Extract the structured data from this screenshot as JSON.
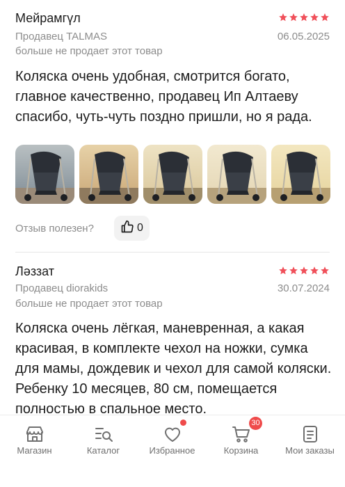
{
  "colors": {
    "star": "#f0505a",
    "accent": "#ef4b4b",
    "muted": "#8c8c8c",
    "icon": "#6f6f6f"
  },
  "reviews": [
    {
      "author": "Мейрамгүл",
      "rating": 5,
      "seller": "Продавец TALMAS",
      "date": "06.05.2025",
      "status": "больше не продает этот товар",
      "text": "Коляска очень удобная, смотрится богато, главное качественно, продавец Ип Алтаеву спасибо, чуть-чуть поздно пришли, но я рада.",
      "photos": [
        "stroller-photo",
        "stroller-photo",
        "stroller-photo",
        "stroller-photo",
        "stroller-photo"
      ],
      "helpful_label": "Отзыв полезен?",
      "likes": "0"
    },
    {
      "author": "Ләззат",
      "rating": 5,
      "seller": "Продавец diorakids",
      "date": "30.07.2024",
      "status": "больше не продает этот товар",
      "text": "Коляска очень лёгкая, маневренная, а какая красивая, в комплекте чехол на ножки, сумка для мамы, дождевик и чехол для самой коляски. Ребенку 10 месяцев, 80 см, помещается полностью в спальное место."
    }
  ],
  "tabbar": [
    {
      "label": "Магазин",
      "icon": "shop-icon"
    },
    {
      "label": "Каталог",
      "icon": "catalog-icon"
    },
    {
      "label": "Избранное",
      "icon": "heart-icon",
      "has_dot": true
    },
    {
      "label": "Корзина",
      "icon": "cart-icon",
      "badge": "30"
    },
    {
      "label": "Мои заказы",
      "icon": "orders-icon"
    }
  ]
}
